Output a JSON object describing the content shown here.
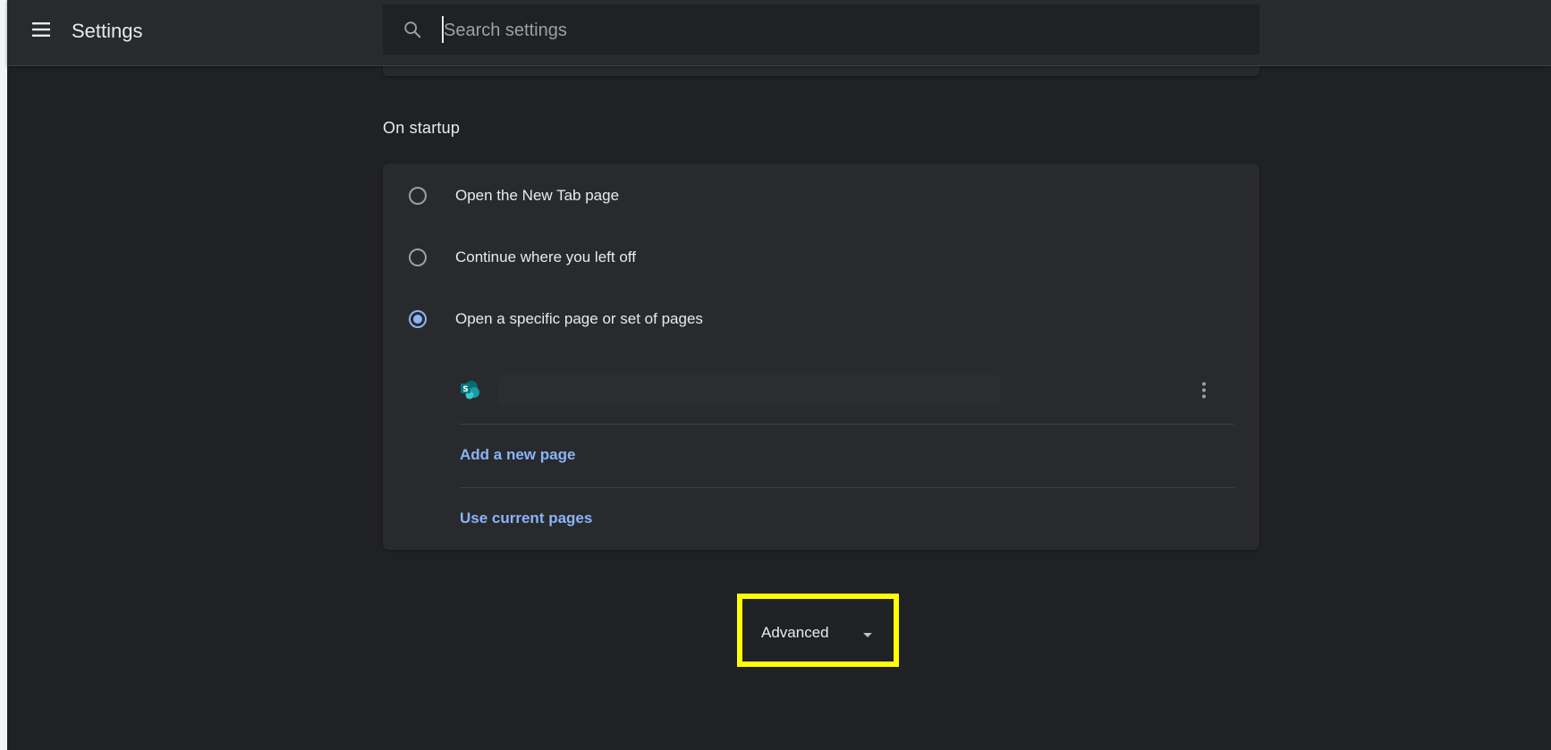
{
  "toolbar": {
    "title": "Settings",
    "menu_icon": "hamburger-menu-icon",
    "search": {
      "placeholder": "Search settings",
      "value": "",
      "icon": "search-icon"
    }
  },
  "on_startup": {
    "section_title": "On startup",
    "options": [
      {
        "label": "Open the New Tab page",
        "checked": false
      },
      {
        "label": "Continue where you left off",
        "checked": false
      },
      {
        "label": "Open a specific page or set of pages",
        "checked": true
      }
    ],
    "pages": [
      {
        "favicon": "sharepoint-icon",
        "more_icon": "more-vert-icon"
      }
    ],
    "add_page_label": "Add a new page",
    "use_current_label": "Use current pages"
  },
  "advanced": {
    "label": "Advanced",
    "icon": "arrow-drop-down-icon"
  },
  "colors": {
    "background": "#202124",
    "toolbar": "#292a2d",
    "card": "#292a2d",
    "accent": "#8ab4f8",
    "text": "#e8eaed",
    "highlight": "#ffff00"
  }
}
